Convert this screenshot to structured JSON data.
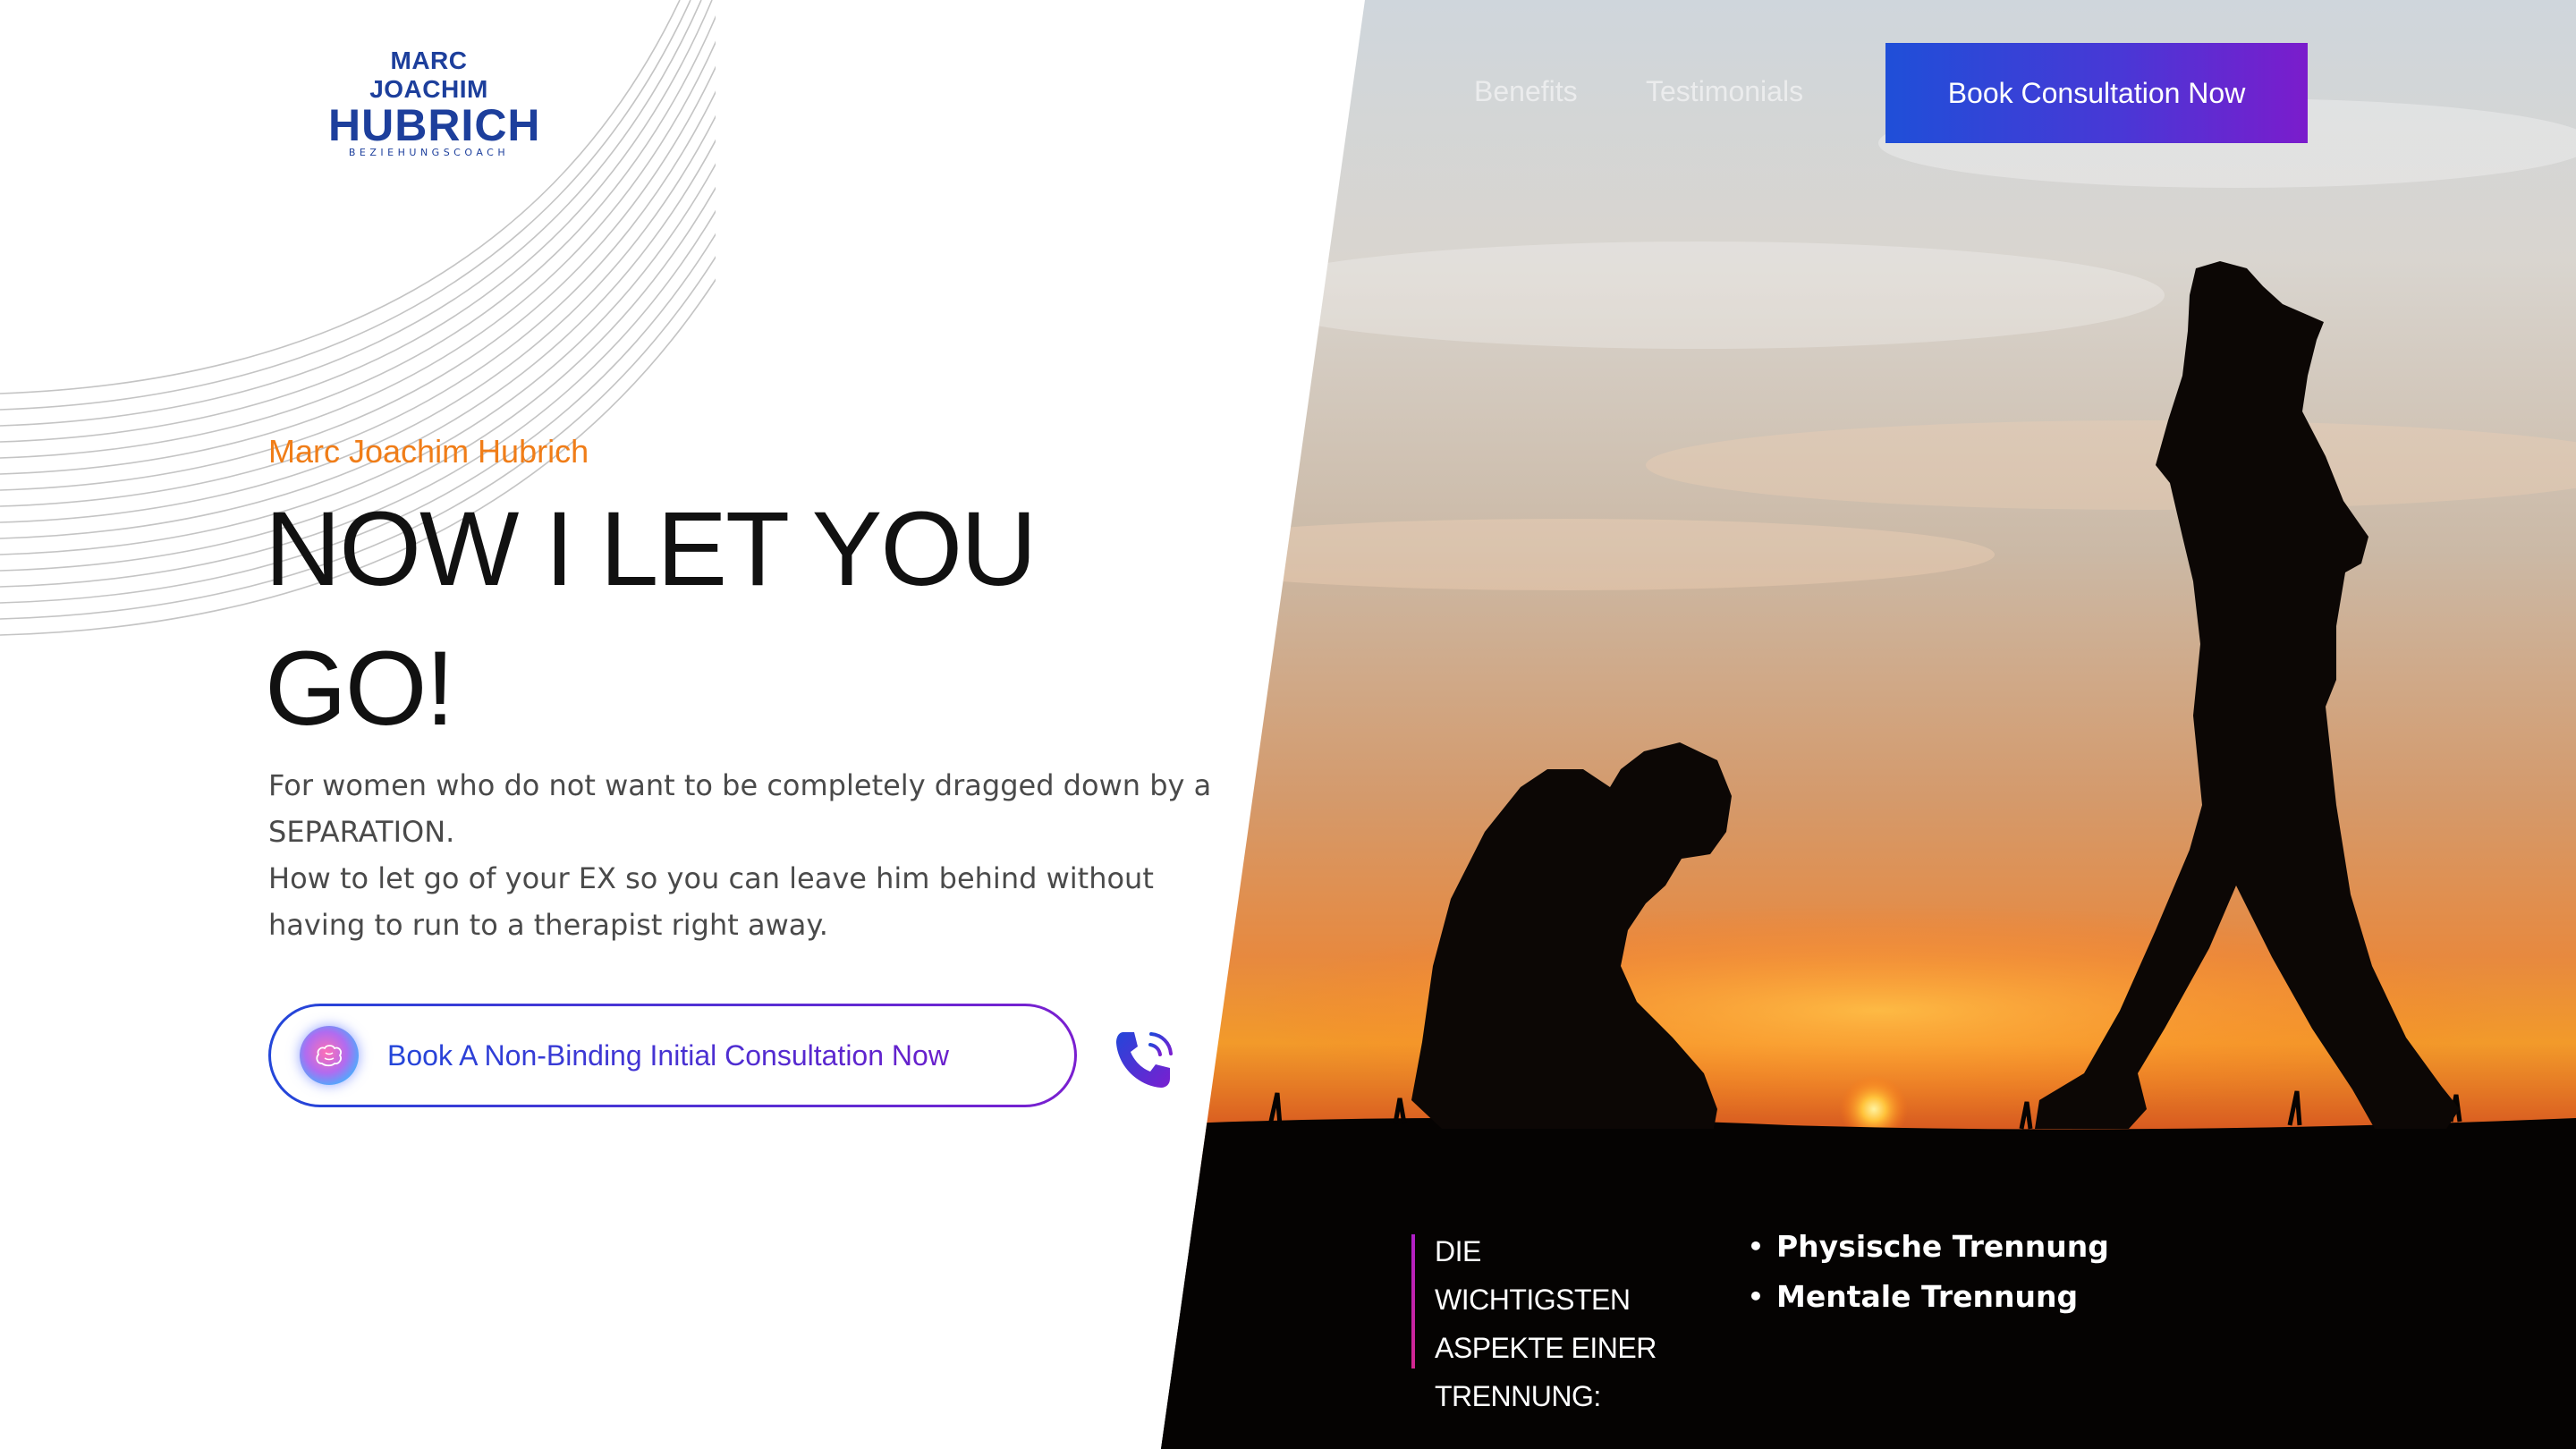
{
  "brand": {
    "name_line1": "MARC JOACHIM",
    "name_line2": "HUBRICH",
    "tagline": "BEZIEHUNGSCOACH",
    "primary_color": "#1d3f9c",
    "accent_color": "#f07d18"
  },
  "nav": {
    "links": [
      {
        "label": "Benefits"
      },
      {
        "label": "Testimonials"
      }
    ],
    "cta_label": "Book Consultation Now"
  },
  "hero": {
    "eyebrow": "Marc Joachim Hubrich",
    "headline": "NOW I LET YOU GO!",
    "paragraph1": "For women who do not want to be completely dragged down by a SEPARATION.",
    "paragraph2": "How to let go of your EX so you can leave him behind without having to run to a therapist right away.",
    "cta_label": "Book A Non-Binding Initial Consultation Now",
    "cta_icon": "brain-orb-icon",
    "phone_icon": "phone-call-icon"
  },
  "aspects": {
    "title": "DIE WICHTIGSTEN ASPEKTE EINER TRENNUNG:",
    "items": [
      "Physische Trennung",
      "Mentale Trennung"
    ]
  },
  "image": {
    "subject": "sunset-silhouette-kneeling-man-and-walking-woman"
  }
}
